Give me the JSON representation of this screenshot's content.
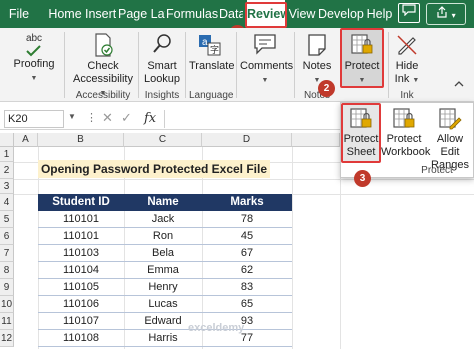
{
  "tabs": [
    "File",
    "Home",
    "Insert",
    "Page Layout",
    "Formulas",
    "Data",
    "Review",
    "View",
    "Developer",
    "Help"
  ],
  "active_tab": "Review",
  "ribbon": {
    "proofing": {
      "label": "Proofing",
      "group": "",
      "icon_text": "abc"
    },
    "accessibility": {
      "label1": "Check",
      "label2": "Accessibility",
      "group": "Accessibility"
    },
    "smart_lookup": {
      "label1": "Smart",
      "label2": "Lookup",
      "group": "Insights"
    },
    "translate": {
      "label": "Translate",
      "group": "Language"
    },
    "comments": {
      "label": "Comments"
    },
    "notes": {
      "label": "Notes",
      "group": "Notes"
    },
    "protect": {
      "label": "Protect"
    },
    "hide_ink": {
      "label1": "Hide",
      "label2": "Ink",
      "group": "Ink"
    }
  },
  "protect_menu": {
    "protect_sheet": {
      "label1": "Protect",
      "label2": "Sheet"
    },
    "protect_workbook": {
      "label1": "Protect",
      "label2": "Workbook"
    },
    "allow_edit_ranges": {
      "label1": "Allow Edit",
      "label2": "Ranges"
    },
    "group": "Protect"
  },
  "badges": [
    "1",
    "2",
    "3"
  ],
  "formula_bar": {
    "name_box": "K20",
    "fx": "fx",
    "value": ""
  },
  "columns": [
    "A",
    "B",
    "C",
    "D"
  ],
  "rows": [
    "1",
    "2",
    "3",
    "4",
    "5",
    "6",
    "7",
    "8",
    "9",
    "10",
    "11",
    "12"
  ],
  "sheet": {
    "title": "Opening Password Protected Excel File",
    "headers": [
      "Student ID",
      "Name",
      "Marks"
    ],
    "data": [
      [
        "110101",
        "Jack",
        "78"
      ],
      [
        "110101",
        "Ron",
        "45"
      ],
      [
        "110103",
        "Bela",
        "67"
      ],
      [
        "110104",
        "Emma",
        "62"
      ],
      [
        "110105",
        "Henry",
        "83"
      ],
      [
        "110106",
        "Lucas",
        "65"
      ],
      [
        "110107",
        "Edward",
        "93"
      ],
      [
        "110108",
        "Harris",
        "77"
      ]
    ]
  },
  "watermark": "exceldemy",
  "colors": {
    "brand": "#217346",
    "header_fill": "#203864",
    "title_fill": "#fdf1cc",
    "highlight": "#e03a3a"
  }
}
